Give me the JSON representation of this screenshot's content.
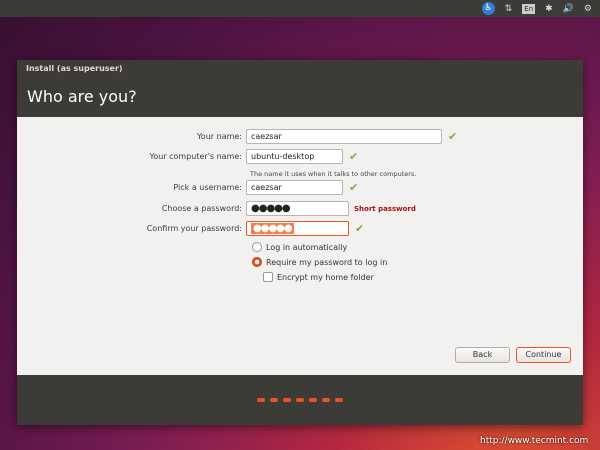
{
  "panel": {
    "accessibility": "♿",
    "network": "⇅",
    "keyboard": "En",
    "bluetooth": "✱",
    "volume": "🔊",
    "power": "⚙"
  },
  "window": {
    "title": "Install (as superuser)",
    "heading": "Who are you?"
  },
  "form": {
    "name_label": "Your name:",
    "name_value": "caezsar",
    "computer_label": "Your computer's name:",
    "computer_value": "ubuntu-desktop",
    "computer_hint": "The name it uses when it talks to other computers.",
    "username_label": "Pick a username:",
    "username_value": "caezsar",
    "password_label": "Choose a password:",
    "password_value": "●●●●●",
    "password_strength": "Short password",
    "confirm_label": "Confirm your password:",
    "confirm_value": "●●●●●",
    "check": "✔",
    "login_auto": "Log in automatically",
    "login_require": "Require my password to log in",
    "encrypt": "Encrypt my home folder"
  },
  "buttons": {
    "back": "Back",
    "continue": "Continue"
  },
  "progress": {
    "total_steps": 7
  },
  "watermark": "http://www.tecmint.com",
  "colors": {
    "accent": "#e95420",
    "check": "#7ab33a",
    "error": "#aa1111"
  }
}
